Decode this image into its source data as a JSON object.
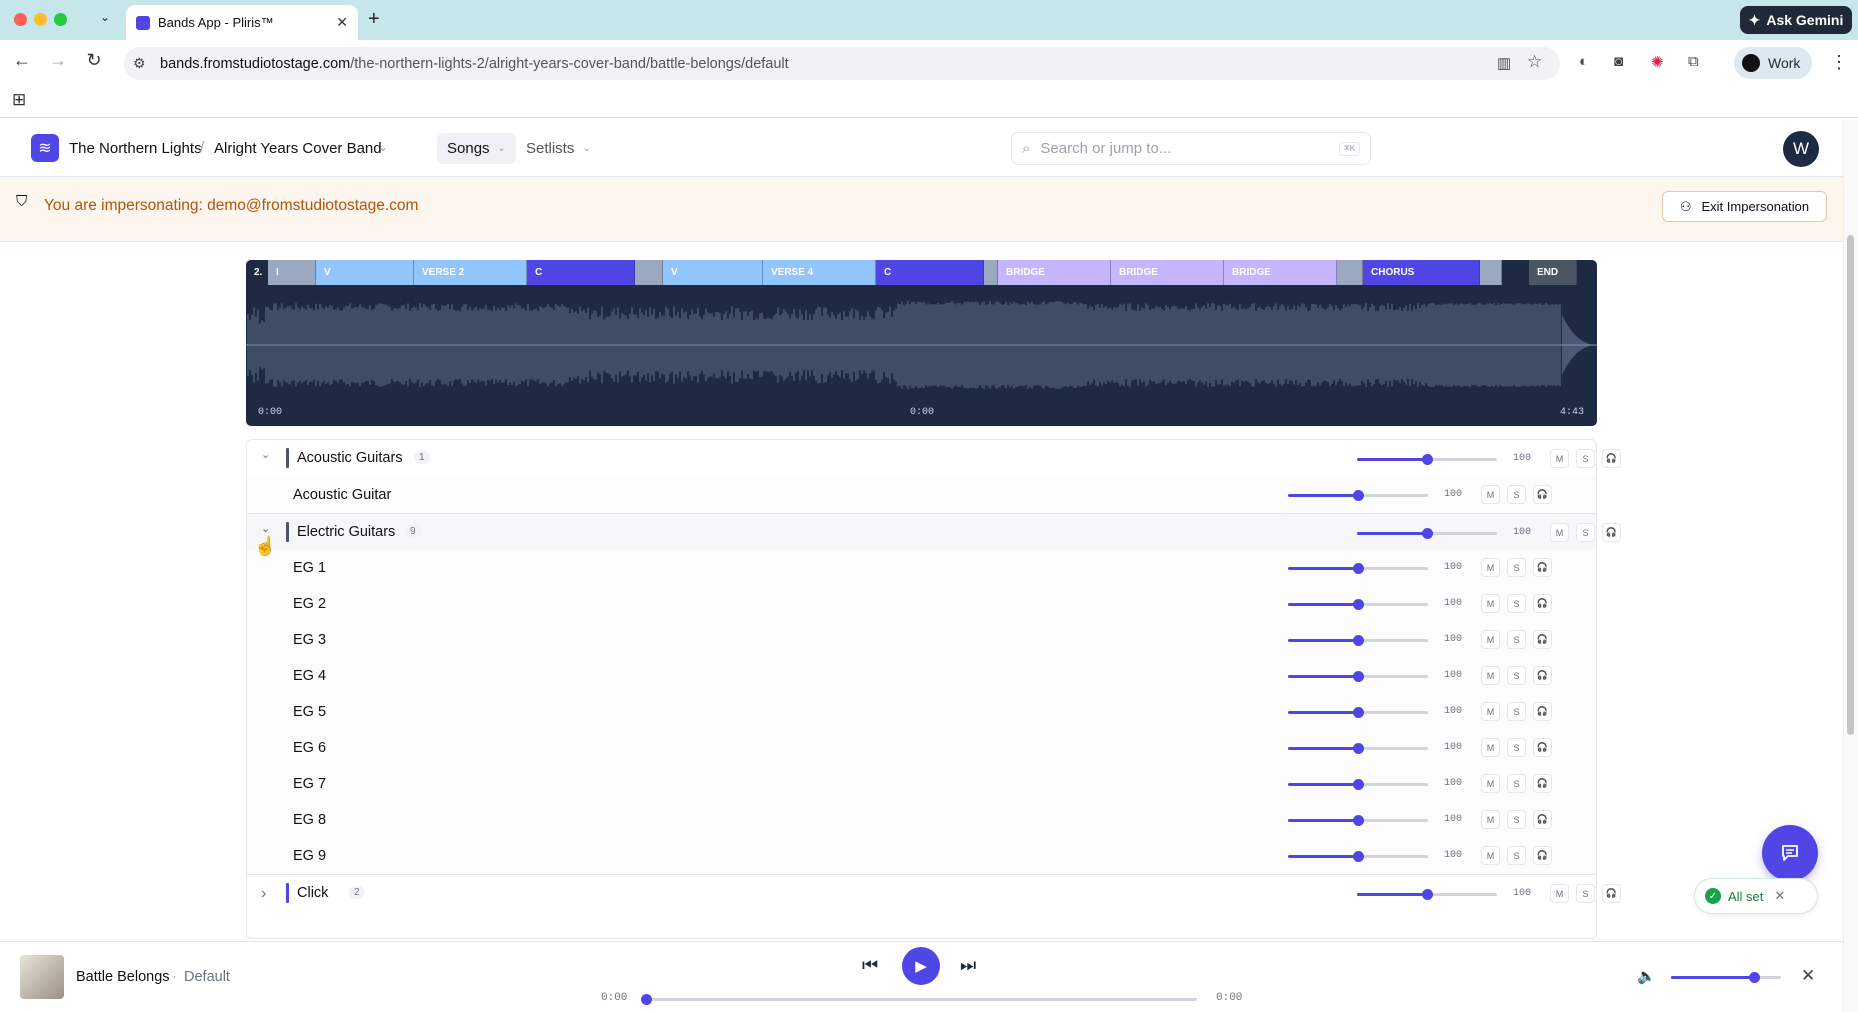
{
  "browser": {
    "tab_title": "Bands App - Pliris™",
    "url_host": "bands.fromstudiotostage.com",
    "url_path": "/the-northern-lights-2/alright-years-cover-band/battle-belongs/default",
    "ask_gemini": "Ask Gemini",
    "profile_label": "Work"
  },
  "header": {
    "org": "The Northern Lights",
    "band": "Alright Years Cover Band",
    "nav_songs": "Songs",
    "nav_setlists": "Setlists",
    "search_placeholder": "Search or jump to...",
    "search_shortcut": "⌘K",
    "avatar_initial": "W"
  },
  "impersonation": {
    "text": "You are impersonating: demo@fromstudiotostage.com",
    "exit_label": "Exit Impersonation"
  },
  "waveform": {
    "sections": [
      {
        "label": "2.",
        "color": "#1e2a44",
        "w": 22
      },
      {
        "label": "I",
        "color": "#9aa8c2",
        "w": 48
      },
      {
        "label": "V",
        "color": "#93c5fd",
        "w": 98
      },
      {
        "label": "VERSE 2",
        "color": "#93c5fd",
        "w": 113
      },
      {
        "label": "C",
        "color": "#4f46e5",
        "w": 108
      },
      {
        "label": "",
        "color": "#9aa8c2",
        "w": 28
      },
      {
        "label": "V",
        "color": "#93c5fd",
        "w": 100
      },
      {
        "label": "VERSE 4",
        "color": "#93c5fd",
        "w": 113
      },
      {
        "label": "C",
        "color": "#4f46e5",
        "w": 108
      },
      {
        "label": "",
        "color": "#9aa8c2",
        "w": 14
      },
      {
        "label": "BRIDGE",
        "color": "#c4b5fd",
        "w": 113
      },
      {
        "label": "BRIDGE",
        "color": "#c4b5fd",
        "w": 113
      },
      {
        "label": "BRIDGE",
        "color": "#c4b5fd",
        "w": 113
      },
      {
        "label": "",
        "color": "#9aa8c2",
        "w": 26
      },
      {
        "label": "CHORUS",
        "color": "#4f46e5",
        "w": 117
      },
      {
        "label": "",
        "color": "#9aa8c2",
        "w": 22
      },
      {
        "label": "",
        "color": "#1e2a44",
        "w": 27
      },
      {
        "label": "END",
        "color": "#4b5563",
        "w": 48
      }
    ],
    "time_start": "0:00",
    "time_mid": "0:00",
    "time_end": "4:43"
  },
  "tracks": {
    "mute_label": "M",
    "solo_label": "S",
    "groups": [
      {
        "name": "Acoustic Guitars",
        "count": "1",
        "volume": "100",
        "expanded": true,
        "color": "#4b5563",
        "tracks": [
          {
            "name": "Acoustic Guitar",
            "volume": "100"
          }
        ]
      },
      {
        "name": "Electric Guitars",
        "count": "9",
        "volume": "100",
        "expanded": true,
        "color": "#4b5563",
        "tracks": [
          {
            "name": "EG 1",
            "volume": "100"
          },
          {
            "name": "EG 2",
            "volume": "100"
          },
          {
            "name": "EG 3",
            "volume": "100"
          },
          {
            "name": "EG 4",
            "volume": "100"
          },
          {
            "name": "EG 5",
            "volume": "100"
          },
          {
            "name": "EG 6",
            "volume": "100"
          },
          {
            "name": "EG 7",
            "volume": "100"
          },
          {
            "name": "EG 8",
            "volume": "100"
          },
          {
            "name": "EG 9",
            "volume": "100"
          }
        ]
      },
      {
        "name": "Click",
        "count": "2",
        "volume": "100",
        "expanded": false,
        "color": "#4f46e5",
        "tracks": []
      }
    ]
  },
  "toast": {
    "text": "All set"
  },
  "player": {
    "song_title": "Battle Belongs",
    "separator": "·",
    "version": "Default",
    "time_current": "0:00",
    "time_duration": "0:00",
    "progress": 0,
    "master_volume": 0.75
  },
  "colors": {
    "accent": "#4f46e5",
    "waveform_bg": "#1e2a44",
    "warning_text": "#b45309"
  }
}
